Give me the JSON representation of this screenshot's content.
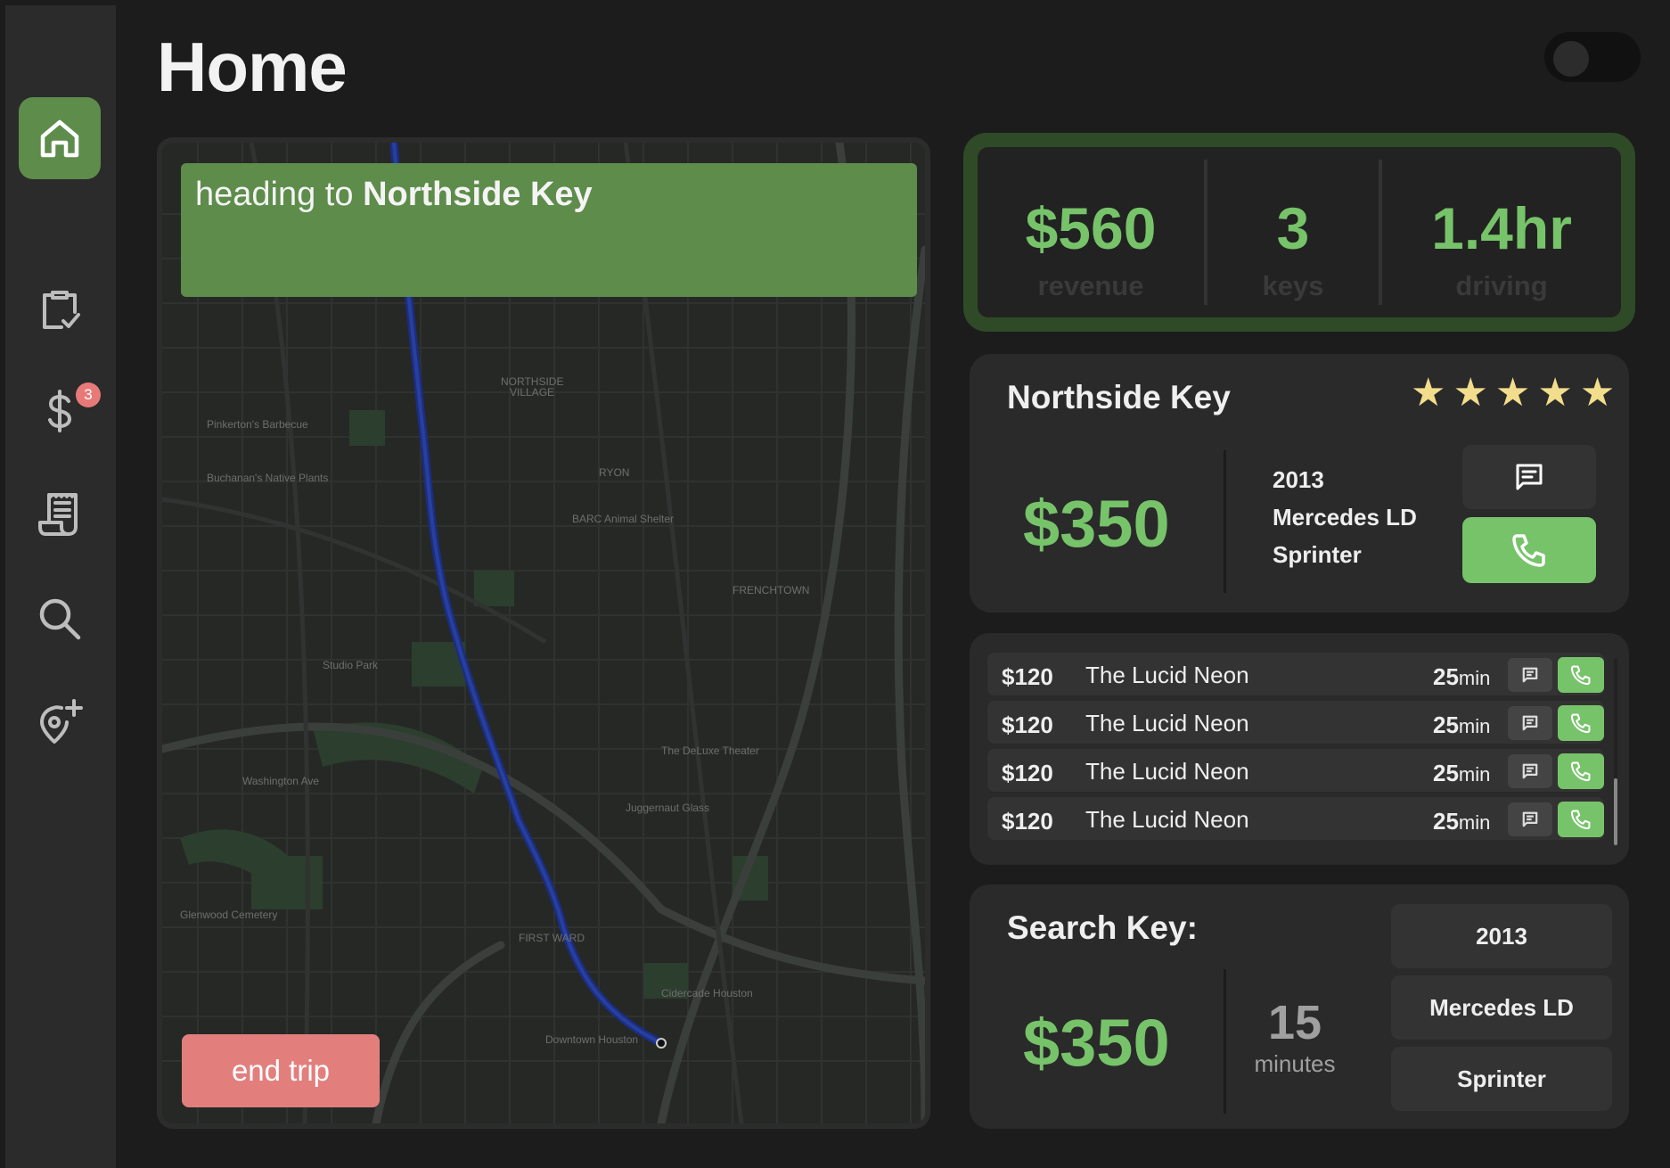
{
  "page_title": "Home",
  "sidebar": {
    "items": [
      {
        "id": "home",
        "icon": "home-icon",
        "active": true
      },
      {
        "id": "tasks",
        "icon": "clipboard-check-icon"
      },
      {
        "id": "payments",
        "icon": "dollar-icon",
        "badge": "3"
      },
      {
        "id": "receipts",
        "icon": "receipt-icon"
      },
      {
        "id": "search",
        "icon": "search-icon"
      },
      {
        "id": "add-location",
        "icon": "location-add-icon"
      }
    ]
  },
  "map": {
    "heading_prefix": "heading to ",
    "destination": "Northside Key",
    "end_trip_label": "end trip"
  },
  "stats": [
    {
      "value": "$560",
      "label": "revenue"
    },
    {
      "value": "3",
      "label": "keys"
    },
    {
      "value": "1.4hr",
      "label": "driving"
    }
  ],
  "current_customer": {
    "name": "Northside Key",
    "rating": 5,
    "stars": "★★★★★",
    "price": "$350",
    "vehicle_year": "2013",
    "vehicle_make": "Mercedes LD",
    "vehicle_model": "Sprinter"
  },
  "queue": [
    {
      "price": "$120",
      "name": "The Lucid Neon",
      "time_num": "25",
      "time_unit": "min"
    },
    {
      "price": "$120",
      "name": "The Lucid Neon",
      "time_num": "25",
      "time_unit": "min"
    },
    {
      "price": "$120",
      "name": "The Lucid Neon",
      "time_num": "25",
      "time_unit": "min"
    },
    {
      "price": "$120",
      "name": "The Lucid Neon",
      "time_num": "25",
      "time_unit": "min"
    }
  ],
  "search_key": {
    "title": "Search Key:",
    "price": "$350",
    "minutes_value": "15",
    "minutes_label": "minutes",
    "options": [
      "2013",
      "Mercedes LD",
      "Sprinter"
    ]
  },
  "colors": {
    "accent_green": "#77c36a",
    "banner_green": "#5e8c4b",
    "end_trip_red": "#e27f7d",
    "star_yellow": "#f2dd8c",
    "background": "#1c1c1c"
  }
}
